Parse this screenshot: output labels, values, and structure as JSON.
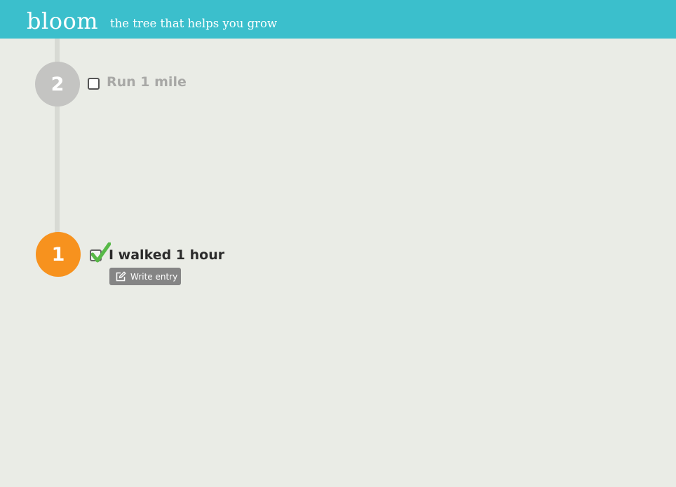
{
  "header": {
    "brand": "bloom",
    "tagline": "the tree that helps you grow"
  },
  "colors": {
    "header": "#3bbfcc",
    "background": "#eaece6",
    "pending_node": "#c4c4c2",
    "completed_node": "#f7921e",
    "checkmark": "#57b947",
    "write_button": "#858585"
  },
  "goals": [
    {
      "number": "2",
      "label": "Run 1 mile",
      "completed": false
    },
    {
      "number": "1",
      "label": "I walked 1 hour",
      "completed": true,
      "action_label": "Write entry",
      "action_icon": "edit-icon"
    }
  ]
}
